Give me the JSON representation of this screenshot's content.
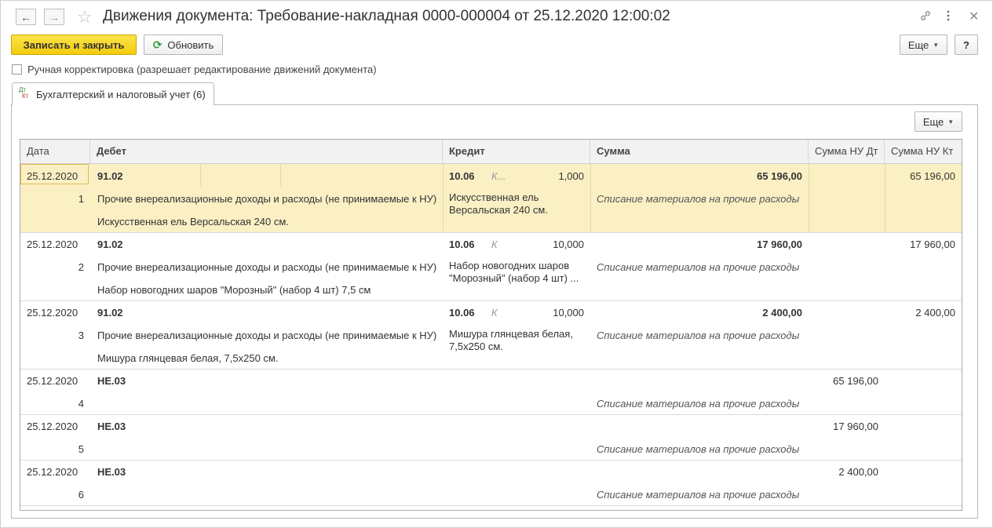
{
  "window": {
    "title": "Движения документа: Требование-накладная 0000-000004 от 25.12.2020 12:00:02"
  },
  "toolbar": {
    "save_close": "Записать и закрыть",
    "refresh": "Обновить",
    "more": "Еще",
    "help": "?"
  },
  "manual_edit": {
    "label": "Ручная корректировка (разрешает редактирование движений документа)",
    "checked": false
  },
  "tab": {
    "icon_top": "Дт",
    "icon_bottom": "Кт",
    "label": "Бухгалтерский и налоговый учет (6)"
  },
  "table": {
    "more": "Еще",
    "columns": [
      "Дата",
      "Дебет",
      "Кредит",
      "Сумма",
      "Сумма НУ Дт",
      "Сумма НУ Кт"
    ],
    "rows": [
      {
        "date": "25.12.2020",
        "num": "1",
        "debit_account": "91.02",
        "debit_sub1": "Прочие внереализационные доходы и расходы (не принимаемые к НУ)",
        "debit_sub2": "Искусственная ель Версальская 240 см.",
        "credit_account": "10.06",
        "credit_k": "К...",
        "credit_qty": "1,000",
        "credit_sub1": "Искусственная ель Версальская 240 см.",
        "sum": "65 196,00",
        "content": "Списание материалов на прочие расходы",
        "nu_dt": "",
        "nu_kt": "65 196,00"
      },
      {
        "date": "25.12.2020",
        "num": "2",
        "debit_account": "91.02",
        "debit_sub1": "Прочие внереализационные доходы и расходы (не принимаемые к НУ)",
        "debit_sub2": "Набор новогодних шаров \"Морозный\" (набор 4 шт) 7,5 см",
        "credit_account": "10.06",
        "credit_k": "К",
        "credit_qty": "10,000",
        "credit_sub1": "Набор новогодних шаров \"Морозный\" (набор 4 шт) ...",
        "sum": "17 960,00",
        "content": "Списание материалов на прочие расходы",
        "nu_dt": "",
        "nu_kt": "17 960,00"
      },
      {
        "date": "25.12.2020",
        "num": "3",
        "debit_account": "91.02",
        "debit_sub1": "Прочие внереализационные доходы и расходы (не принимаемые к НУ)",
        "debit_sub2": "Мишура глянцевая белая, 7,5x250 см.",
        "credit_account": "10.06",
        "credit_k": "К",
        "credit_qty": "10,000",
        "credit_sub1": "Мишура глянцевая белая, 7,5x250 см.",
        "sum": "2 400,00",
        "content": "Списание материалов на прочие расходы",
        "nu_dt": "",
        "nu_kt": "2 400,00"
      },
      {
        "date": "25.12.2020",
        "num": "4",
        "debit_account": "НЕ.03",
        "debit_sub1": "",
        "debit_sub2": "",
        "credit_account": "",
        "credit_k": "",
        "credit_qty": "",
        "credit_sub1": "",
        "sum": "",
        "content": "Списание материалов на прочие расходы",
        "nu_dt": "65 196,00",
        "nu_kt": ""
      },
      {
        "date": "25.12.2020",
        "num": "5",
        "debit_account": "НЕ.03",
        "debit_sub1": "",
        "debit_sub2": "",
        "credit_account": "",
        "credit_k": "",
        "credit_qty": "",
        "credit_sub1": "",
        "sum": "",
        "content": "Списание материалов на прочие расходы",
        "nu_dt": "17 960,00",
        "nu_kt": ""
      },
      {
        "date": "25.12.2020",
        "num": "6",
        "debit_account": "НЕ.03",
        "debit_sub1": "",
        "debit_sub2": "",
        "credit_account": "",
        "credit_k": "",
        "credit_qty": "",
        "credit_sub1": "",
        "sum": "",
        "content": "Списание материалов на прочие расходы",
        "nu_dt": "2 400,00",
        "nu_kt": ""
      }
    ]
  }
}
